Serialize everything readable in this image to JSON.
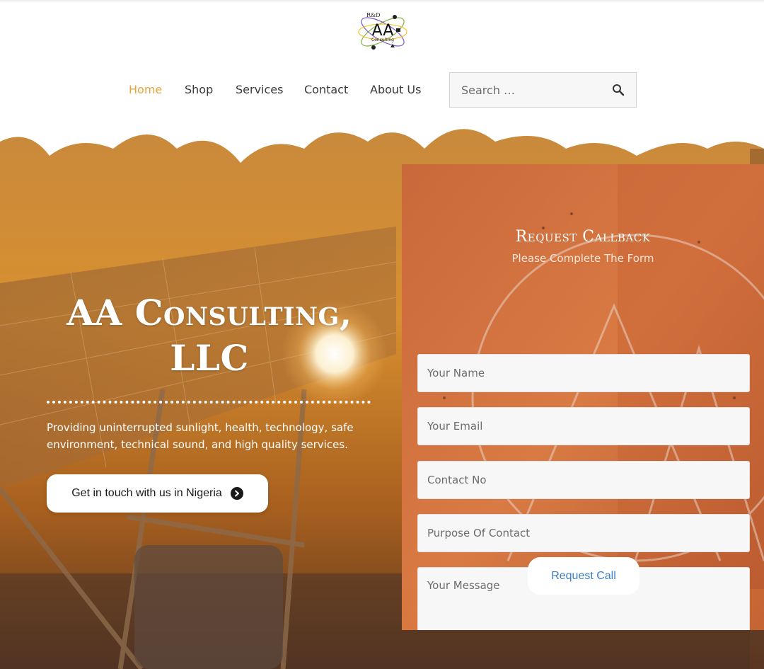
{
  "logo": {
    "line1": "R&D",
    "main": "AA",
    "line2": "Consulting"
  },
  "nav": {
    "items": [
      {
        "label": "Home",
        "active": true
      },
      {
        "label": "Shop"
      },
      {
        "label": "Services"
      },
      {
        "label": "Contact"
      },
      {
        "label": "About Us"
      }
    ],
    "active_color": "#e8a33d"
  },
  "search": {
    "placeholder": "Search …",
    "icon": "search-icon"
  },
  "hero": {
    "title": "AA Consulting, LLC",
    "subtitle": "Providing uninterrupted sunlight, health, technology, safe environment, technical sound, and high quality services.",
    "cta_label": "Get in touch with us in Nigeria",
    "cta_icon": "chevron-circle-right-icon"
  },
  "form": {
    "title": "Request Callback",
    "subtitle": "Please Complete The Form",
    "fields": {
      "name_placeholder": "Your Name",
      "email_placeholder": "Your Email",
      "phone_placeholder": "Contact No",
      "purpose_placeholder": "Purpose Of Contact",
      "message_placeholder": "Your Message"
    },
    "submit_label": "Request Call",
    "submit_color": "#3d7fc0"
  }
}
